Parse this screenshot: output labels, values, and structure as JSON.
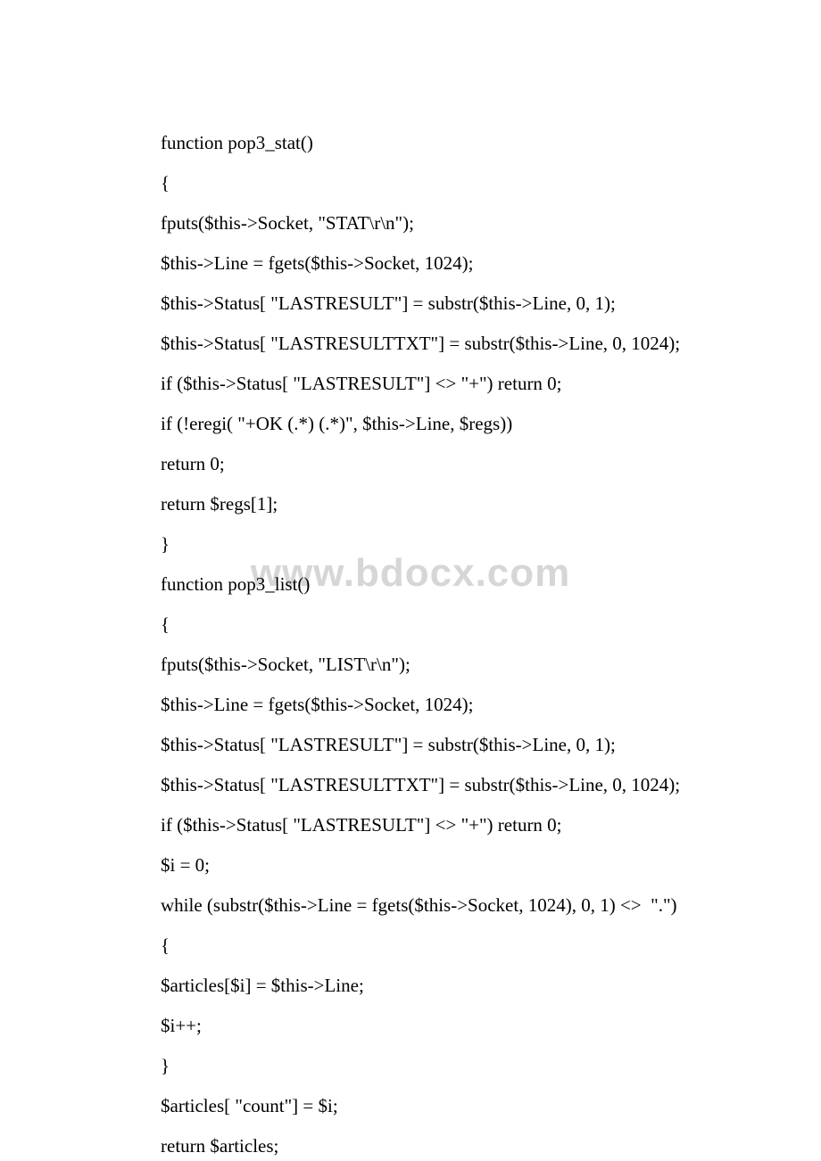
{
  "watermark": "www.bdocx.com",
  "lines": [
    "function pop3_stat()",
    "{",
    "fputs($this->Socket, \"STAT\\r\\n\");",
    "$this->Line = fgets($this->Socket, 1024);",
    "$this->Status[ \"LASTRESULT\"] = substr($this->Line, 0, 1);",
    "$this->Status[ \"LASTRESULTTXT\"] = substr($this->Line, 0, 1024);",
    "if ($this->Status[ \"LASTRESULT\"] <> \"+\") return 0;",
    "if (!eregi( \"+OK (.*) (.*)\", $this->Line, $regs))",
    "return 0;",
    "return $regs[1];",
    "}",
    "function pop3_list()",
    "{",
    "fputs($this->Socket, \"LIST\\r\\n\");",
    "$this->Line = fgets($this->Socket, 1024);",
    "$this->Status[ \"LASTRESULT\"] = substr($this->Line, 0, 1);",
    "$this->Status[ \"LASTRESULTTXT\"] = substr($this->Line, 0, 1024);",
    "if ($this->Status[ \"LASTRESULT\"] <> \"+\") return 0;",
    "$i = 0;",
    "while (substr($this->Line = fgets($this->Socket, 1024), 0, 1) <>  \".\")",
    "{",
    "$articles[$i] = $this->Line;",
    "$i++;",
    "}",
    "$articles[ \"count\"] = $i;",
    "return $articles;"
  ]
}
